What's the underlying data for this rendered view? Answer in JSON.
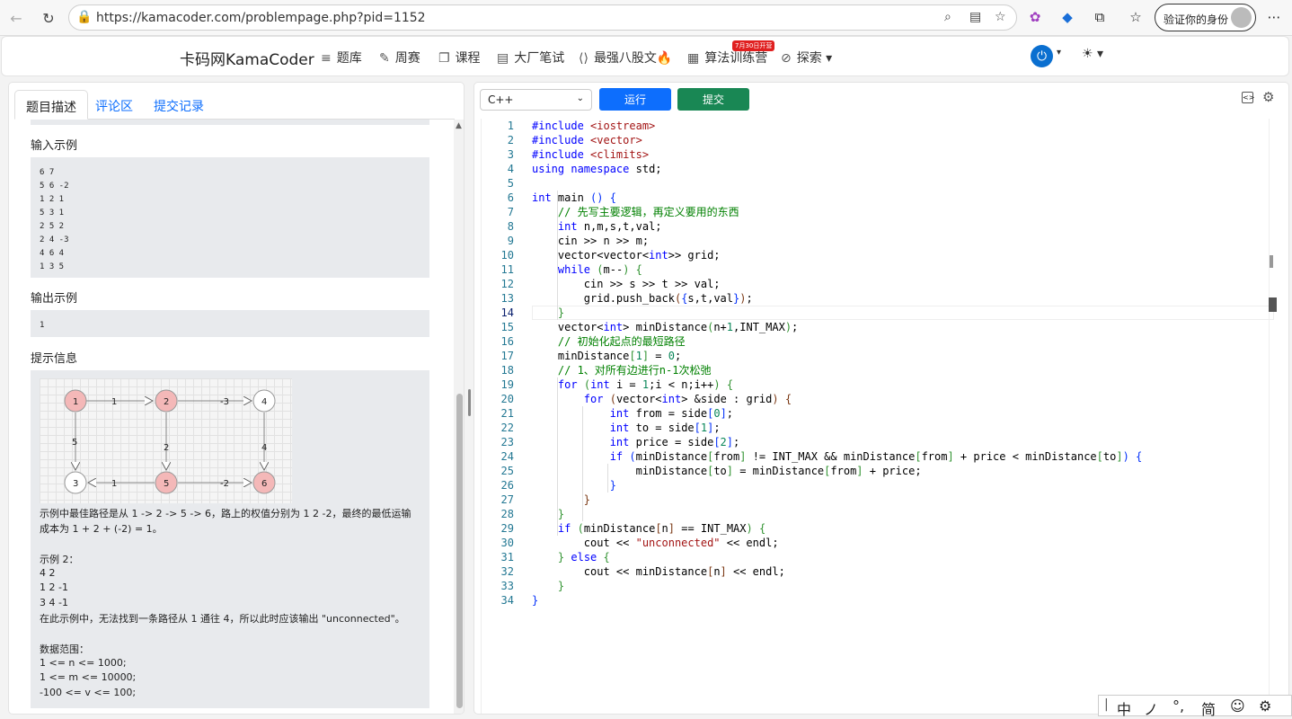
{
  "browser": {
    "url": "https://kamacoder.com/problempage.php?pid=1152",
    "verify_label": "验证你的身份"
  },
  "site": {
    "logo": "卡码网KamaCoder",
    "nav": [
      "题库",
      "周赛",
      "课程",
      "大厂笔试",
      "最强八股文🔥",
      "算法训练营",
      "探索"
    ],
    "badge": "7月30日开营"
  },
  "left": {
    "tabs": [
      "题目描述",
      "评论区",
      "提交记录"
    ],
    "input_title": "输入示例",
    "input_lines": [
      "6 7",
      "5 6 -2",
      "1 2 1",
      "5 3 1",
      "2 5 2",
      "2 4 -3",
      "4 6 4",
      "1 3 5"
    ],
    "output_title": "输出示例",
    "output_lines": [
      "1"
    ],
    "tips_title": "提示信息",
    "graph": {
      "nodes": [
        "1",
        "2",
        "4",
        "3",
        "5",
        "6"
      ],
      "weights": [
        "1",
        "-3",
        "5",
        "2",
        "4",
        "1",
        "-2"
      ]
    },
    "tips": [
      "示例中最佳路径是从 1 -> 2 -> 5 -> 6，路上的权值分别为 1 2 -2，最终的最低运输",
      "成本为 1 + 2 + (-2) = 1。",
      "示例 2：",
      "4 2",
      "1 2 -1",
      "3 4 -1",
      "在此示例中，无法找到一条路径从 1 通往 4，所以此时应该输出 \"unconnected\"。",
      "数据范围：",
      "1 <= n <= 1000;",
      "1 <= m <= 10000;",
      "-100 <= v <= 100;"
    ]
  },
  "editor": {
    "language": "C++",
    "run_label": "运行",
    "submit_label": "提交",
    "current_line": 14
  },
  "ime": [
    "中",
    "ノ",
    "°,",
    "简",
    "☺",
    "⚙"
  ],
  "colors": {
    "run": "#0d6efd",
    "submit": "#198754"
  }
}
